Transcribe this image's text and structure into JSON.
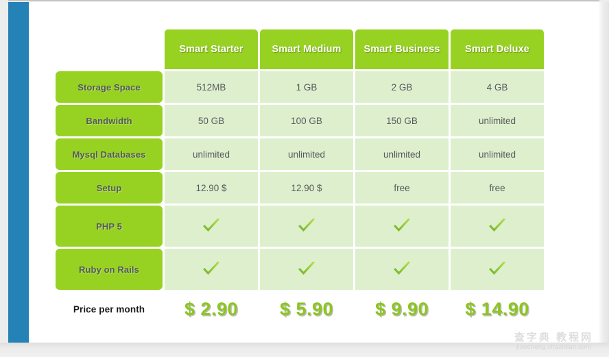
{
  "theme": {
    "rail_color": "#2482b6",
    "header_green": "#97d223",
    "cell_green": "#deefcd",
    "price_green": "#8cc61e",
    "label_text": "#555a5c"
  },
  "table": {
    "corner_label": "",
    "plans": [
      {
        "name": "Smart Starter"
      },
      {
        "name": "Smart Medium"
      },
      {
        "name": "Smart Business"
      },
      {
        "name": "Smart Deluxe"
      }
    ],
    "rows": [
      {
        "label": "Storage Space",
        "values": [
          "512MB",
          "1 GB",
          "2 GB",
          "4 GB"
        ],
        "type": "text"
      },
      {
        "label": "Bandwidth",
        "values": [
          "50 GB",
          "100 GB",
          "150 GB",
          "unlimited"
        ],
        "type": "text"
      },
      {
        "label": "Mysql Databases",
        "values": [
          "unlimited",
          "unlimited",
          "unlimited",
          "unlimited"
        ],
        "type": "text"
      },
      {
        "label": "Setup",
        "values": [
          "12.90 $",
          "12.90 $",
          "free",
          "free"
        ],
        "type": "text"
      },
      {
        "label": "PHP 5",
        "values": [
          "check",
          "check",
          "check",
          "check"
        ],
        "type": "check"
      },
      {
        "label": "Ruby on Rails",
        "values": [
          "check",
          "check",
          "check",
          "check"
        ],
        "type": "check"
      }
    ],
    "price_row": {
      "label": "Price per month",
      "values": [
        "$ 2.90",
        "$ 5.90",
        "$ 9.90",
        "$ 14.90"
      ]
    }
  },
  "watermark": {
    "cjk": "查字典 教程网",
    "url": "jiaocheng.chazidian.com"
  }
}
